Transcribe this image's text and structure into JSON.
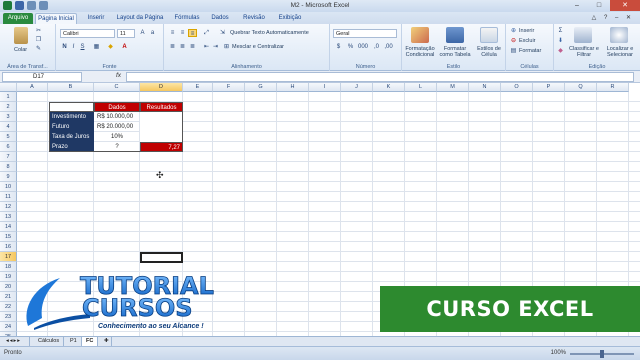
{
  "window": {
    "title": "M2 - Microsoft Excel",
    "minimize": "–",
    "maximize": "□",
    "close": "✕"
  },
  "tabs": {
    "file": "Arquivo",
    "items": [
      "Página Inicial",
      "Inserir",
      "Layout da Página",
      "Fórmulas",
      "Dados",
      "Revisão",
      "Exibição"
    ],
    "active": "Página Inicial"
  },
  "ribbon": {
    "clipboard": {
      "paste_label": "Colar",
      "group_label": "Área de Transf..."
    },
    "font": {
      "font_name": "Calibri",
      "font_size": "11",
      "group_label": "Fonte"
    },
    "alignment": {
      "wrap_text": "Quebrar Texto Automaticamente",
      "merge_center": "Mesclar e Centralizar",
      "group_label": "Alinhamento"
    },
    "number": {
      "format": "Geral",
      "group_label": "Número"
    },
    "styles": {
      "conditional": "Formatação Condicional",
      "as_table": "Formatar como Tabela",
      "cell_styles": "Estilos de Célula",
      "group_label": "Estilo"
    },
    "cells": {
      "insert": "Inserir",
      "delete": "Excluir",
      "format": "Formatar",
      "group_label": "Células"
    },
    "editing": {
      "sort_filter": "Classificar e Filtrar",
      "find_select": "Localizar e Selecionar",
      "group_label": "Edição"
    }
  },
  "formula_bar": {
    "name_box": "D17",
    "fx": "fx",
    "formula": ""
  },
  "grid": {
    "columns": [
      "A",
      "B",
      "C",
      "D",
      "E",
      "F",
      "G",
      "H",
      "I",
      "J",
      "K",
      "L",
      "M",
      "N",
      "O",
      "P",
      "Q",
      "R"
    ],
    "rows": [
      "1",
      "2",
      "3",
      "4",
      "5",
      "6",
      "7",
      "8",
      "9",
      "10",
      "11",
      "12",
      "13",
      "14",
      "15",
      "16",
      "17",
      "18",
      "19",
      "20",
      "21",
      "22",
      "23",
      "24",
      "25"
    ],
    "selected_col": "D",
    "selected_row": "17"
  },
  "table": {
    "header_dados": "Dados",
    "header_resultados": "Resultados",
    "labels": [
      "Investimento",
      "Futuro",
      "Taxa de Juros",
      "Prazo"
    ],
    "values": [
      "R$ 10.000,00",
      "R$ 20.000,00",
      "10%",
      "?"
    ],
    "result": "7,27"
  },
  "overlay": {
    "logo_line1": "TUTORIAL",
    "logo_line2": "CURSOS",
    "logo_tagline": "Conhecimento ao seu Alcance !",
    "banner": "CURSO EXCEL"
  },
  "sheets": {
    "items": [
      "Cálculos",
      "P1",
      "FC"
    ],
    "active": "FC"
  },
  "status": {
    "mode": "Pronto",
    "zoom": "100%"
  },
  "colors": {
    "table_header": "#c00000",
    "table_label_bg": "#1f3864",
    "banner_green": "#2d8a2f",
    "file_tab": "#2a8a3e"
  }
}
